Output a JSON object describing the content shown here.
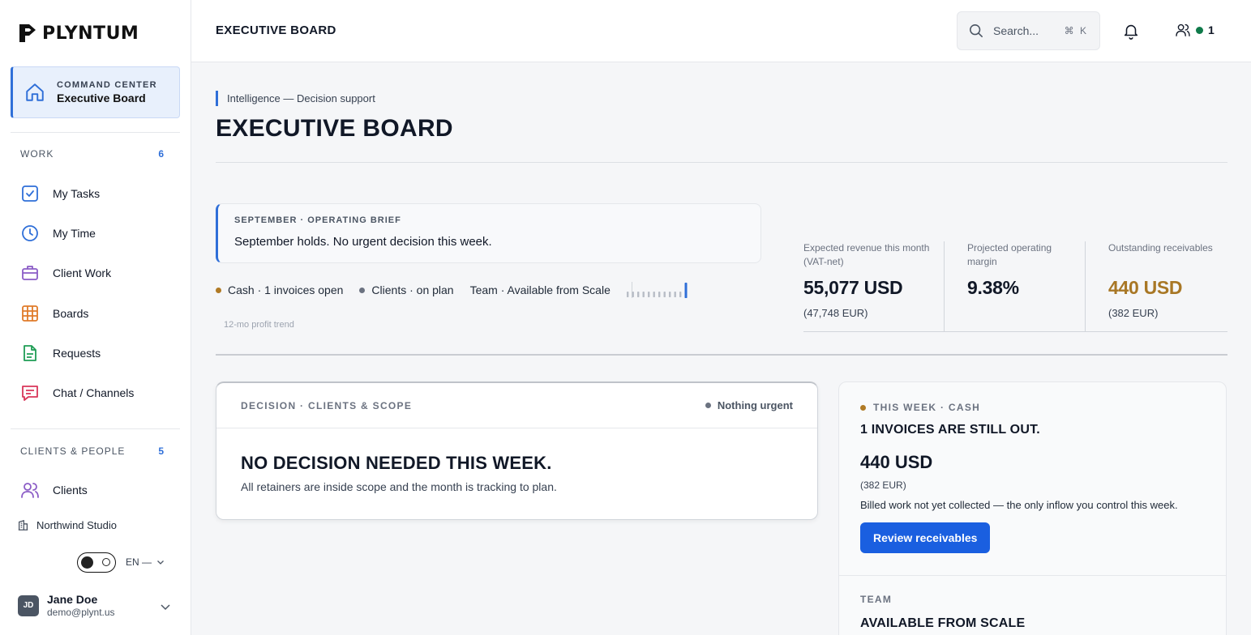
{
  "brand": {
    "name": "PLYNTUM"
  },
  "sidebar": {
    "command_center": {
      "kicker": "COMMAND CENTER",
      "title": "Executive Board"
    },
    "sections": [
      {
        "title": "WORK",
        "count": "6",
        "items": [
          {
            "label": "My Tasks",
            "icon": "check-square-icon",
            "color": "#2f6fd8"
          },
          {
            "label": "My Time",
            "icon": "clock-icon",
            "color": "#2f6fd8"
          },
          {
            "label": "Client Work",
            "icon": "briefcase-icon",
            "color": "#8b5cc6"
          },
          {
            "label": "Boards",
            "icon": "board-grid-icon",
            "color": "#e07b2a"
          },
          {
            "label": "Requests",
            "icon": "document-icon",
            "color": "#1f9d55"
          },
          {
            "label": "Chat / Channels",
            "icon": "chat-icon",
            "color": "#d9365a"
          }
        ]
      },
      {
        "title": "CLIENTS & PEOPLE",
        "count": "5",
        "items": [
          {
            "label": "Clients",
            "icon": "users-icon",
            "color": "#8b5cc6"
          }
        ]
      }
    ],
    "workspace": "Northwind Studio",
    "language": "EN —",
    "user": {
      "initials": "JD",
      "name": "Jane Doe",
      "email": "demo@plynt.us"
    }
  },
  "header": {
    "title": "EXECUTIVE BOARD",
    "search": {
      "placeholder": "Search...",
      "shortcut": "⌘ K"
    },
    "presence_count": "1"
  },
  "main": {
    "breadcrumb": "Intelligence — Decision support",
    "title": "EXECUTIVE BOARD",
    "brief": {
      "kicker": "SEPTEMBER · OPERATING BRIEF",
      "text": "September holds. No urgent decision this week."
    },
    "signals": [
      {
        "label": "Cash · 1 invoices open",
        "color": "#b07a25"
      },
      {
        "label": "Clients · on plan",
        "color": "#6b7280"
      },
      {
        "label": "Team · Available from Scale",
        "color": ""
      }
    ],
    "trend_label": "12-mo profit trend",
    "trend": [
      0.5,
      0.5,
      0.5,
      0.5,
      0.5,
      0.5,
      0.5,
      0.5,
      0.5,
      0.5,
      0.5,
      1
    ],
    "kpis": [
      {
        "label": "Expected revenue this month (VAT-net)",
        "value": "55,077 USD",
        "sub": "(47,748 EUR)",
        "color": "#111827"
      },
      {
        "label": "Projected operating margin",
        "value": "9.38%",
        "sub": "",
        "color": "#111827"
      },
      {
        "label": "Outstanding receivables",
        "value": "440 USD",
        "sub": "(382 EUR)",
        "color": "#a87725"
      }
    ],
    "decision": {
      "kicker": "DECISION · CLIENTS & SCOPE",
      "status": "Nothing urgent",
      "title": "NO DECISION NEEDED THIS WEEK.",
      "text": "All retainers are inside scope and the month is tracking to plan."
    },
    "cash": {
      "kicker": "THIS WEEK · CASH",
      "title": "1 INVOICES ARE STILL OUT.",
      "value": "440 USD",
      "sub": "(382 EUR)",
      "text": "Billed work not yet collected — the only inflow you control this week.",
      "button": "Review receivables",
      "accent": "#b07a25"
    },
    "team": {
      "kicker": "TEAM",
      "title": "AVAILABLE FROM SCALE"
    }
  }
}
